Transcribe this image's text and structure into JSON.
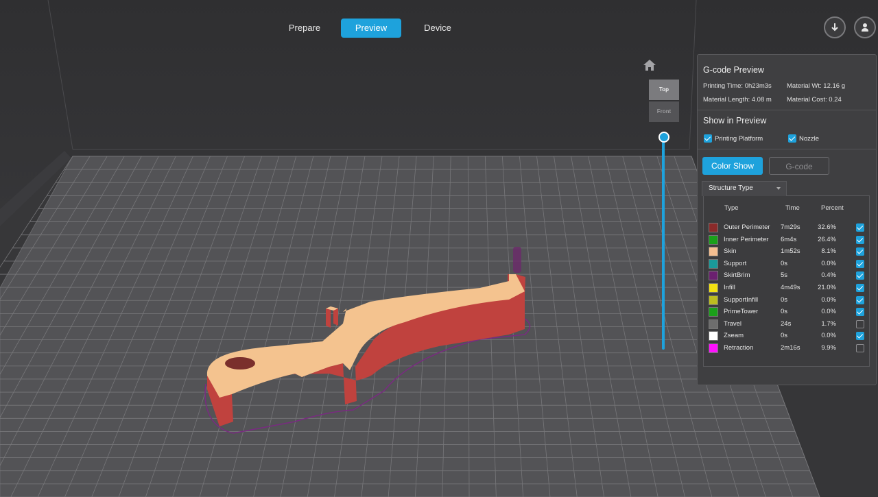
{
  "nav": {
    "tabs": [
      {
        "label": "Prepare",
        "active": false
      },
      {
        "label": "Preview",
        "active": true
      },
      {
        "label": "Device",
        "active": false
      }
    ]
  },
  "toolbar_icons": [
    "download-icon",
    "user-icon"
  ],
  "view_cube": {
    "top": "Top",
    "front": "Front"
  },
  "layer_slider": {
    "position": 1.0
  },
  "panel": {
    "title": "G-code Preview",
    "stats": {
      "printing_time": "Printing Time: 0h23m3s",
      "material_wt": "Material Wt: 12.16 g",
      "material_length": "Material Length: 4.08 m",
      "material_cost": "Material Cost: 0.24"
    },
    "show_title": "Show in Preview",
    "show_options": [
      {
        "label": "Printing Platform",
        "checked": true
      },
      {
        "label": "Nozzle",
        "checked": true
      }
    ],
    "mode_buttons": [
      {
        "label": "Color Show",
        "active": true
      },
      {
        "label": "G-code",
        "active": false
      }
    ],
    "structure_tab": "Structure Type",
    "columns": {
      "type": "Type",
      "time": "Time",
      "percent": "Percent"
    },
    "rows": [
      {
        "name": "Outer Perimeter",
        "time": "7m29s",
        "percent": "32.6%",
        "color": "#8b2a2a",
        "checked": true
      },
      {
        "name": "Inner Perimeter",
        "time": "6m4s",
        "percent": "26.4%",
        "color": "#1aa01a",
        "checked": true
      },
      {
        "name": "Skin",
        "time": "1m52s",
        "percent": "8.1%",
        "color": "#f5bf91",
        "checked": true
      },
      {
        "name": "Support",
        "time": "0s",
        "percent": "0.0%",
        "color": "#1a9a9a",
        "checked": true
      },
      {
        "name": "SkirtBrim",
        "time": "5s",
        "percent": "0.4%",
        "color": "#6b2070",
        "checked": true
      },
      {
        "name": "Infill",
        "time": "4m49s",
        "percent": "21.0%",
        "color": "#f2e212",
        "checked": true
      },
      {
        "name": "SupportInfill",
        "time": "0s",
        "percent": "0.0%",
        "color": "#bcbc20",
        "checked": true
      },
      {
        "name": "PrimeTower",
        "time": "0s",
        "percent": "0.0%",
        "color": "#1aa01a",
        "checked": true
      },
      {
        "name": "Travel",
        "time": "24s",
        "percent": "1.7%",
        "color": "#6e6e6e",
        "checked": false
      },
      {
        "name": "Zseam",
        "time": "0s",
        "percent": "0.0%",
        "color": "#ffffff",
        "checked": true
      },
      {
        "name": "Retraction",
        "time": "2m16s",
        "percent": "9.9%",
        "color": "#ff10ff",
        "checked": false
      }
    ]
  },
  "colors": {
    "accent": "#1ea2dc",
    "part_wall": "#c0423e",
    "part_top": "#f5c58f",
    "travel_line": "#7a2a82"
  }
}
